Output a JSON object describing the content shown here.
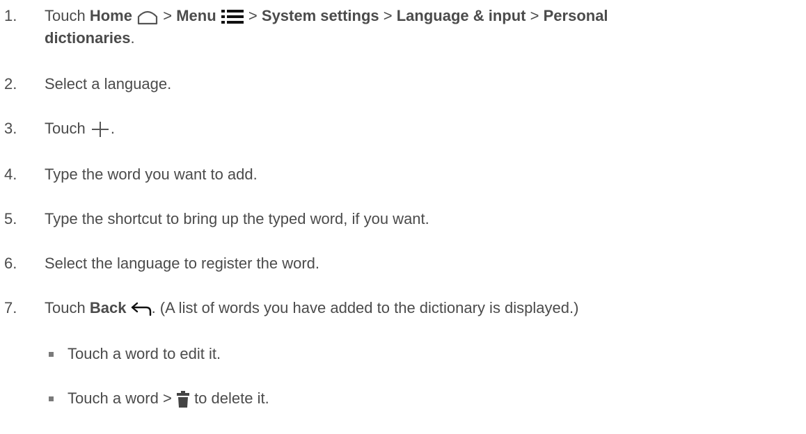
{
  "steps": [
    {
      "num": "1.",
      "parts": {
        "touch": "Touch",
        "home": "Home",
        "sep1": ">",
        "menu": "Menu",
        "sep2": ">",
        "system_settings": "System settings",
        "sep3": ">",
        "language_input": "Language & input",
        "sep4": ">",
        "personal": "Personal",
        "dictionaries": "dictionaries",
        "period": "."
      }
    },
    {
      "num": "2.",
      "text": "Select a language."
    },
    {
      "num": "3.",
      "touch": "Touch",
      "period": "."
    },
    {
      "num": "4.",
      "text": "Type the word you want to add."
    },
    {
      "num": "5.",
      "text": "Type the shortcut to bring up the typed word, if you want."
    },
    {
      "num": "6.",
      "text": "Select the language to register the word."
    },
    {
      "num": "7.",
      "touch": "Touch",
      "back": "Back",
      "rest": ". (A list of words you have added to the dictionary is displayed.)"
    }
  ],
  "sub_items": [
    {
      "text": "Touch a word to edit it."
    },
    {
      "before": "Touch a word >",
      "after": "to delete it."
    }
  ],
  "icons": {
    "home": "home-icon",
    "menu": "menu-icon",
    "add": "plus-icon",
    "back": "back-arrow-icon",
    "delete": "trash-icon"
  },
  "colors": {
    "text": "#4b4b4b",
    "icon": "#555555"
  }
}
